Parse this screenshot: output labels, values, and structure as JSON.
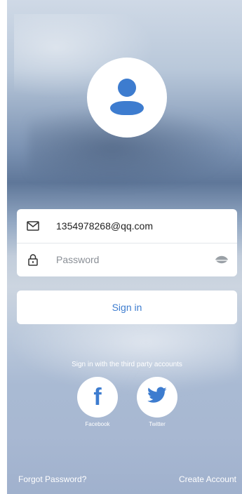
{
  "login_form": {
    "email_value": "1354978268@qq.com",
    "password_placeholder": "Password"
  },
  "sign_in_label": "Sign in",
  "third_party": {
    "heading": "Sign in with the third party accounts",
    "facebook_label": "Facebook",
    "twitter_label": "Twitter",
    "facebook_glyph": "f"
  },
  "footer": {
    "forgot_label": "Forgot Password?",
    "create_label": "Create Account"
  },
  "icons": {
    "avatar": "user-avatar-icon",
    "email": "envelope-icon",
    "password": "lock-icon",
    "visibility": "eye-icon",
    "facebook": "facebook-icon",
    "twitter": "twitter-bird-icon"
  },
  "colors": {
    "accent": "#3d7ccf",
    "card": "#ffffff",
    "text_dark": "#222222",
    "placeholder": "#8a8f96"
  }
}
